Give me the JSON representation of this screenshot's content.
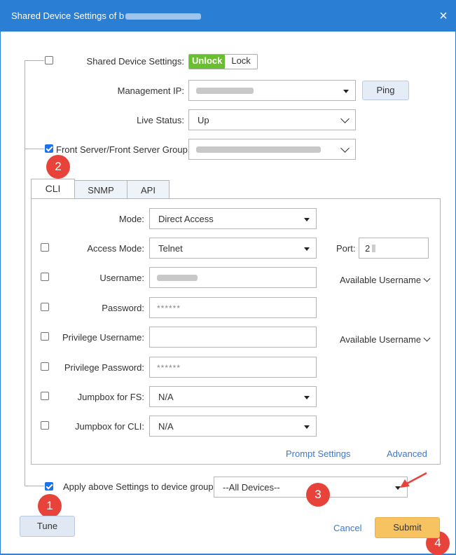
{
  "dialog": {
    "title": "Shared Device Settings of b",
    "close_glyph": "×"
  },
  "shared_settings": {
    "label": "Shared Device Settings:",
    "unlock_label": "Unlock",
    "lock_label": "Lock",
    "checked": false
  },
  "management_ip": {
    "label": "Management IP:",
    "ping_label": "Ping"
  },
  "live_status": {
    "label": "Live Status:",
    "value": "Up"
  },
  "front_server": {
    "label": "Front Server/Front Server Group:",
    "checked": true
  },
  "tabs": [
    {
      "label": "CLI",
      "active": true
    },
    {
      "label": "SNMP",
      "active": false
    },
    {
      "label": "API",
      "active": false
    }
  ],
  "cli": {
    "mode": {
      "label": "Mode:",
      "value": "Direct Access"
    },
    "access_mode": {
      "label": "Access Mode:",
      "value": "Telnet"
    },
    "port": {
      "label": "Port:",
      "value": "2"
    },
    "username": {
      "label": "Username:",
      "available": "Available Username"
    },
    "password": {
      "label": "Password:",
      "value": "******"
    },
    "privilege_username": {
      "label": "Privilege Username:",
      "available": "Available Username"
    },
    "privilege_password": {
      "label": "Privilege Password:",
      "value": "******"
    },
    "jumpbox_fs": {
      "label": "Jumpbox for FS:",
      "value": "N/A"
    },
    "jumpbox_cli": {
      "label": "Jumpbox for CLI:",
      "value": "N/A"
    },
    "prompt_settings": "Prompt Settings",
    "advanced": "Advanced"
  },
  "apply": {
    "label": "Apply above Settings to device group:",
    "value": "--All Devices--",
    "checked": true
  },
  "footer": {
    "tune_label": "Tune",
    "cancel_label": "Cancel",
    "submit_label": "Submit"
  },
  "badges": [
    "1",
    "2",
    "3",
    "4"
  ],
  "colors": {
    "title_bar": "#2a7fd4",
    "unlock_green": "#6abf2e",
    "badge_red": "#e8433a",
    "submit_orange": "#f7c360",
    "link_blue": "#3a7ad3"
  }
}
